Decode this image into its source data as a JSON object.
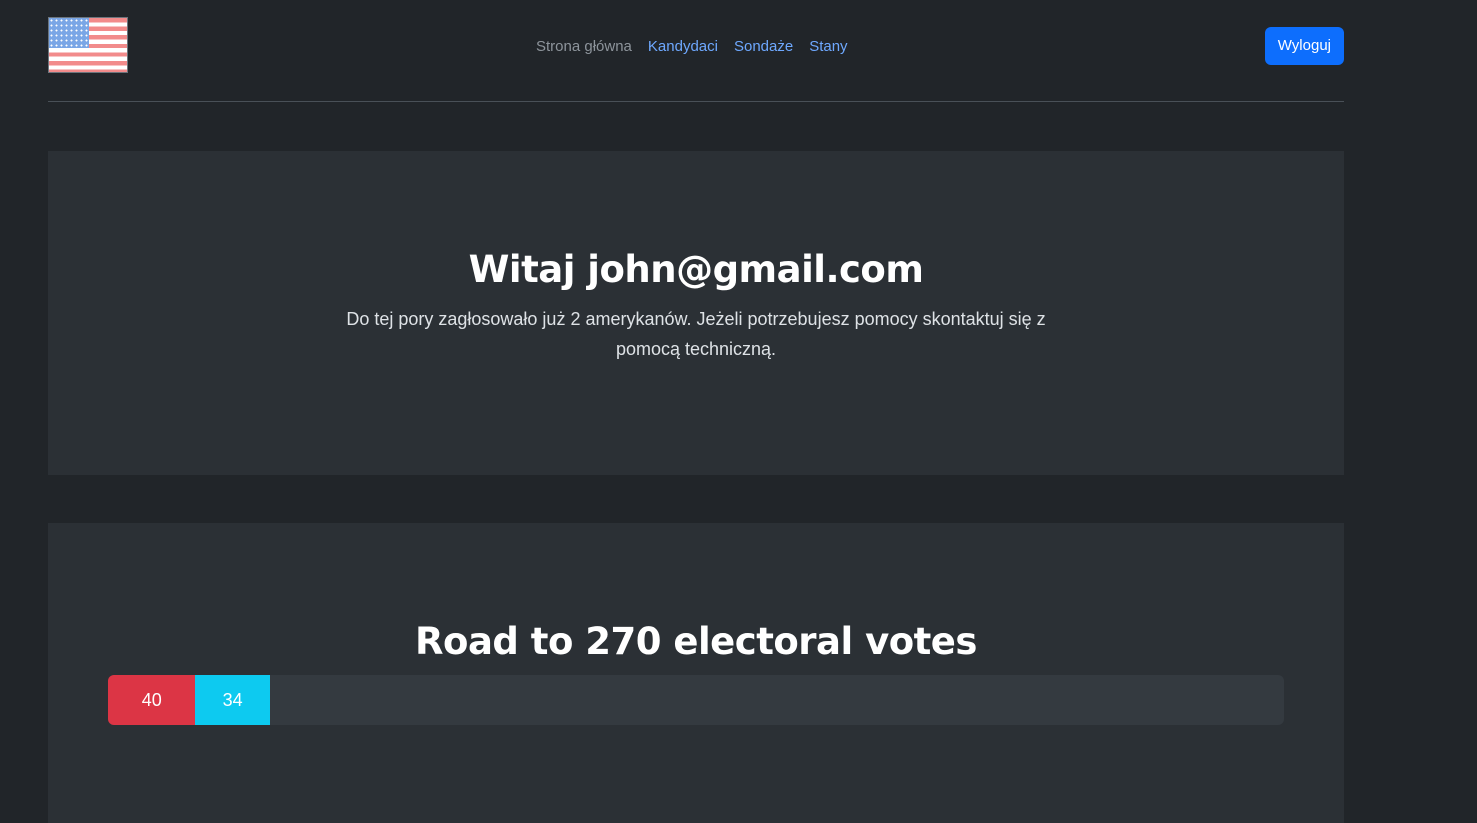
{
  "header": {
    "logo_icon": "us-flag-icon",
    "nav": [
      {
        "label": "Strona główna",
        "state": "inactive"
      },
      {
        "label": "Kandydaci",
        "state": "active"
      },
      {
        "label": "Sondaże",
        "state": "active"
      },
      {
        "label": "Stany",
        "state": "active"
      }
    ],
    "logout_label": "Wyloguj"
  },
  "welcome": {
    "title": "Witaj john@gmail.com",
    "message": "Do tej pory zagłosowało już 2 amerykanów. Jeżeli potrzebujesz pomocy skontaktuj się z pomocą techniczną."
  },
  "votes": {
    "title": "Road to 270 electoral votes",
    "total": 538,
    "segments": [
      {
        "value": 40,
        "label": "40",
        "color": "#dc3545"
      },
      {
        "value": 34,
        "label": "34",
        "color": "#0dcaf0"
      }
    ]
  },
  "colors": {
    "background": "#212529",
    "panel": "#2b3035",
    "accent": "#0d6efd",
    "link": "#6ea8fe"
  }
}
